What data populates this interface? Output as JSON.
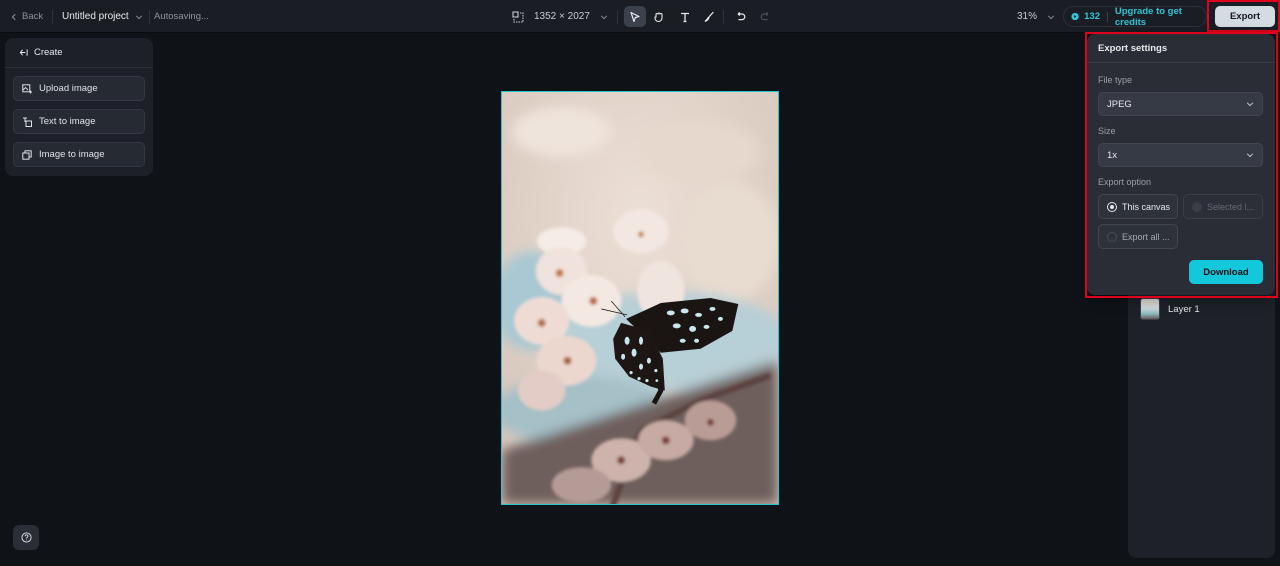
{
  "topbar": {
    "back_label": "Back",
    "project_name": "Untitled project",
    "status": "Autosaving...",
    "canvas_size": "1352 × 2027",
    "tools": [
      {
        "name": "select",
        "icon": "pointer-icon",
        "active": true
      },
      {
        "name": "hand",
        "icon": "hand-icon",
        "active": false
      },
      {
        "name": "text",
        "icon": "text-icon",
        "active": false
      },
      {
        "name": "brush",
        "icon": "brush-icon",
        "active": false
      },
      {
        "name": "undo",
        "icon": "undo-icon",
        "active": false
      },
      {
        "name": "redo",
        "icon": "redo-icon",
        "active": false
      }
    ],
    "zoom_level": "31%",
    "credits_count": "132",
    "upgrade_label": "Upgrade to get credits",
    "export_label": "Export"
  },
  "create_panel": {
    "title": "Create",
    "items": [
      {
        "label": "Upload image",
        "icon": "upload-image-icon"
      },
      {
        "label": "Text to image",
        "icon": "text-to-image-icon"
      },
      {
        "label": "Image to image",
        "icon": "image-to-image-icon"
      }
    ]
  },
  "canvas": {
    "image_description": "Black and white butterfly on pink cherry blossoms"
  },
  "layers": {
    "items": [
      {
        "label": "Layer 1"
      }
    ]
  },
  "export_settings": {
    "title": "Export settings",
    "file_type_label": "File type",
    "file_type_value": "JPEG",
    "size_label": "Size",
    "size_value": "1x",
    "export_option_label": "Export option",
    "options": [
      {
        "label": "This canvas",
        "checked": true,
        "disabled": false
      },
      {
        "label": "Selected l...",
        "checked": false,
        "disabled": true
      },
      {
        "label": "Export all ...",
        "checked": false,
        "disabled": false
      }
    ],
    "download_label": "Download"
  },
  "colors": {
    "accent": "#14c8dc",
    "credits_text": "#33c4d6",
    "highlight": "#e0001b",
    "canvas_border": "#27c6d0"
  }
}
